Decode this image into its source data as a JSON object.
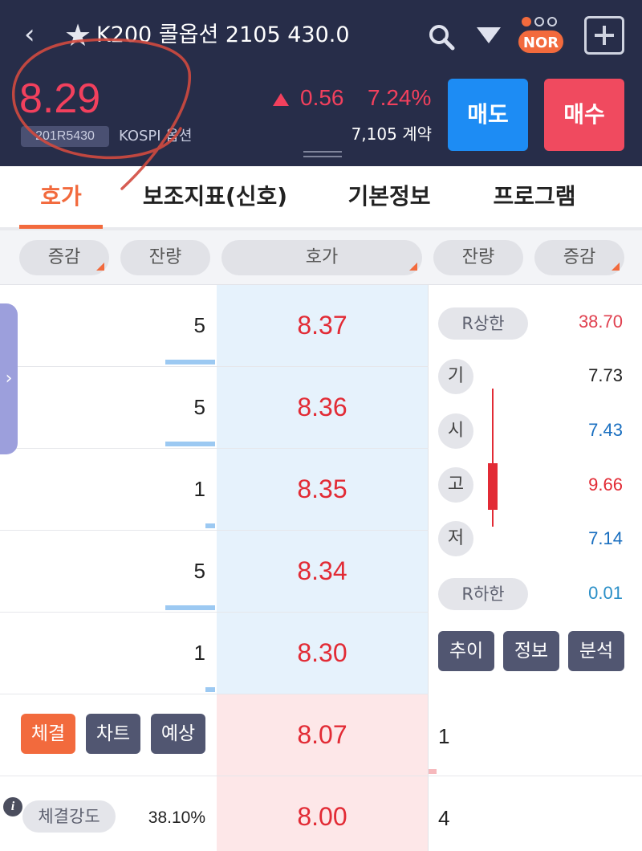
{
  "header": {
    "back_glyph": "‹",
    "star_glyph": "★",
    "title": "K200 콜옵션 2105 430.0",
    "mode_badge": "NOR",
    "price": "8.29",
    "code": "201R5430",
    "market": "KOSPI 옵션",
    "change": "0.56",
    "change_pct": "7.24%",
    "volume": "7,105 계약",
    "sell_label": "매도",
    "buy_label": "매수"
  },
  "colors": {
    "header_bg": "#272d49",
    "up_red": "#f2405d",
    "price_red": "#e22b35",
    "sell_blue": "#1d8cf4",
    "buy_red": "#f04a5f",
    "accent_orange": "#f26a3d",
    "fall_blue": "#1a6fc0"
  },
  "tabs": [
    {
      "label": "호가",
      "active": true
    },
    {
      "label": "보조지표(신호)",
      "active": false
    },
    {
      "label": "기본정보",
      "active": false
    },
    {
      "label": "프로그램",
      "active": false
    }
  ],
  "columns": {
    "change_left": "증감",
    "qty_left": "잔량",
    "price": "호가",
    "qty_right": "잔량",
    "change_right": "증감"
  },
  "asks": [
    {
      "qty": "5",
      "price": "8.37"
    },
    {
      "qty": "5",
      "price": "8.36"
    },
    {
      "qty": "1",
      "price": "8.35"
    },
    {
      "qty": "5",
      "price": "8.34"
    },
    {
      "qty": "1",
      "price": "8.30"
    }
  ],
  "bids": [
    {
      "price": "8.07",
      "qty": "1"
    },
    {
      "price": "8.00",
      "qty": "4"
    }
  ],
  "side_tab_glyph": "›",
  "stats": {
    "upper_limit_label": "R상한",
    "upper_limit": "38.70",
    "prev_label": "기",
    "prev": "7.73",
    "open_label": "시",
    "open": "7.43",
    "high_label": "고",
    "high": "9.66",
    "low_label": "저",
    "low": "7.14",
    "lower_limit_label": "R하한",
    "lower_limit": "0.01"
  },
  "side_buttons": [
    "추이",
    "정보",
    "분석"
  ],
  "bottom_buttons": [
    "체결",
    "차트",
    "예상"
  ],
  "strength": {
    "info_glyph": "i",
    "label": "체결강도",
    "value": "38.10%"
  }
}
